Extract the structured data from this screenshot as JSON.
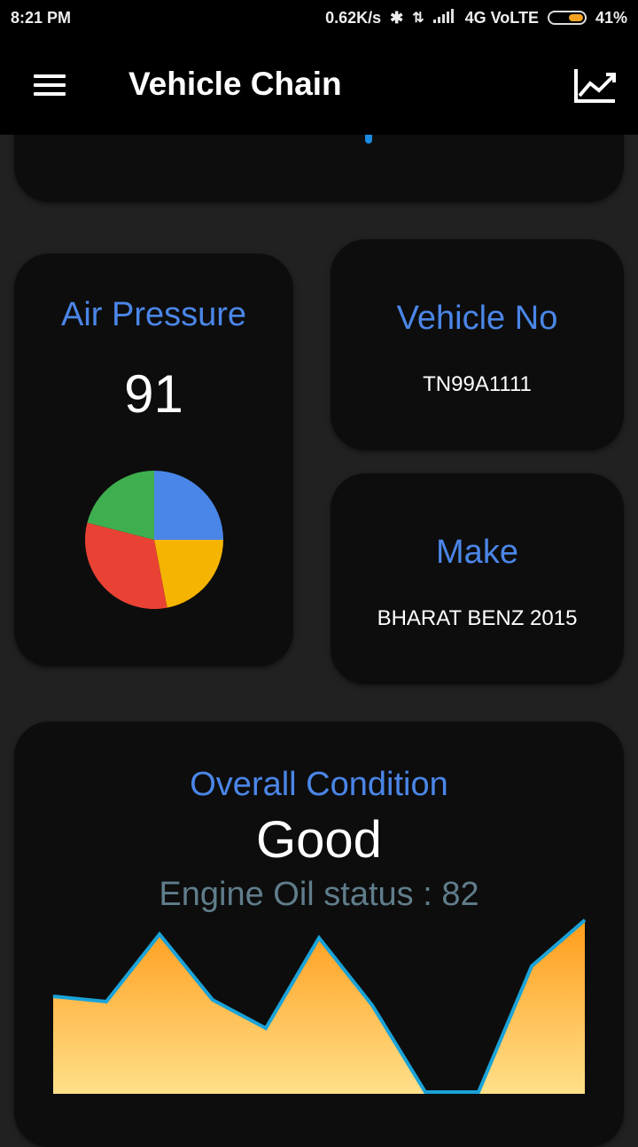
{
  "status_bar": {
    "time": "8:21 PM",
    "speed": "0.62K/s",
    "network": "4G VoLTE",
    "battery": "41%",
    "battery_level": 0.41
  },
  "app_bar": {
    "title": "Vehicle Chain",
    "menu_icon": "menu-icon",
    "chart_icon": "trending-up-icon"
  },
  "air_pressure": {
    "label": "Air Pressure",
    "value": "91",
    "pie": {
      "type": "pie",
      "slices": [
        {
          "value": 25,
          "color": "#4a86e8"
        },
        {
          "value": 22,
          "color": "#f4b400"
        },
        {
          "value": 32,
          "color": "#e94235"
        },
        {
          "value": 21,
          "color": "#3fae4f"
        }
      ]
    }
  },
  "vehicle_no": {
    "label": "Vehicle No",
    "value": "TN99A1111"
  },
  "make": {
    "label": "Make",
    "value": "BHARAT BENZ 2015"
  },
  "overall": {
    "label": "Overall Condition",
    "value": "Good",
    "oil_status": "Engine Oil status : 82"
  },
  "chart_data": {
    "type": "area",
    "values": [
      55,
      52,
      90,
      53,
      37,
      88,
      50,
      1,
      1,
      72,
      98
    ],
    "ylim": [
      0,
      100
    ],
    "line_color": "#1aa3d8",
    "fill_top": "#ff9c1a",
    "fill_bottom": "#ffe08a"
  },
  "colors": {
    "accent": "#4b86e8",
    "card": "#0d0d0d",
    "background": "#212121"
  }
}
